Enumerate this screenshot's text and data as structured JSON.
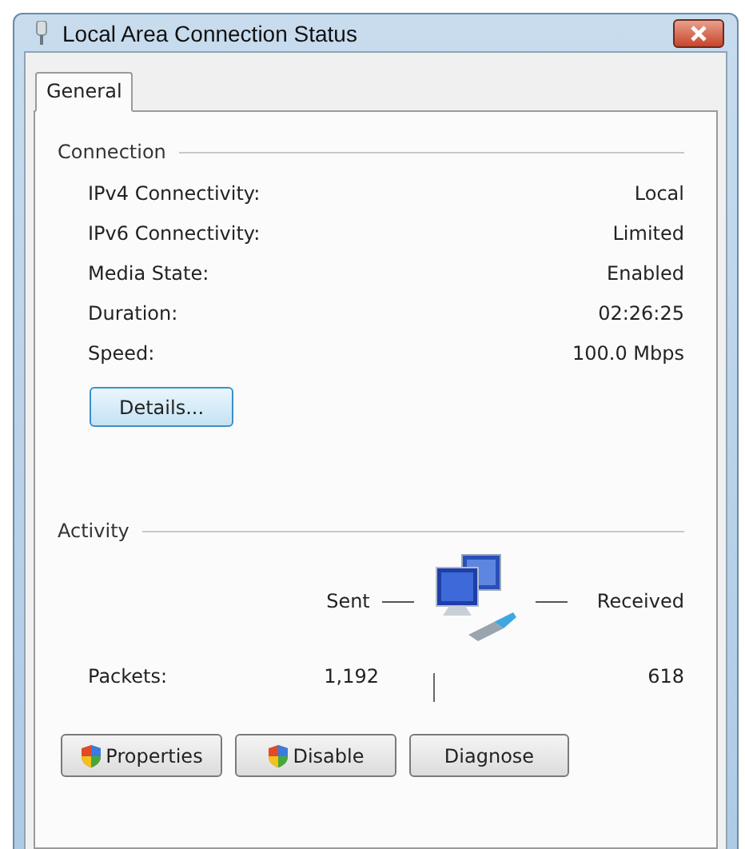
{
  "window": {
    "title": "Local Area Connection Status"
  },
  "tabs": [
    {
      "label": "General",
      "selected": true
    }
  ],
  "connection": {
    "heading": "Connection",
    "rows": [
      {
        "label": "IPv4 Connectivity:",
        "value": "Local"
      },
      {
        "label": "IPv6 Connectivity:",
        "value": "Limited"
      },
      {
        "label": "Media State:",
        "value": "Enabled"
      },
      {
        "label": "Duration:",
        "value": "02:26:25"
      },
      {
        "label": "Speed:",
        "value": "100.0 Mbps"
      }
    ],
    "details_button": "Details..."
  },
  "activity": {
    "heading": "Activity",
    "sent_label": "Sent",
    "received_label": "Received",
    "packets_label": "Packets:",
    "packets_sent": "1,192",
    "packets_received": "618"
  },
  "buttons": [
    {
      "label": "Properties",
      "kind": "shield"
    },
    {
      "label": "Disable",
      "kind": "shield"
    },
    {
      "label": "Diagnose",
      "kind": "plain"
    }
  ]
}
